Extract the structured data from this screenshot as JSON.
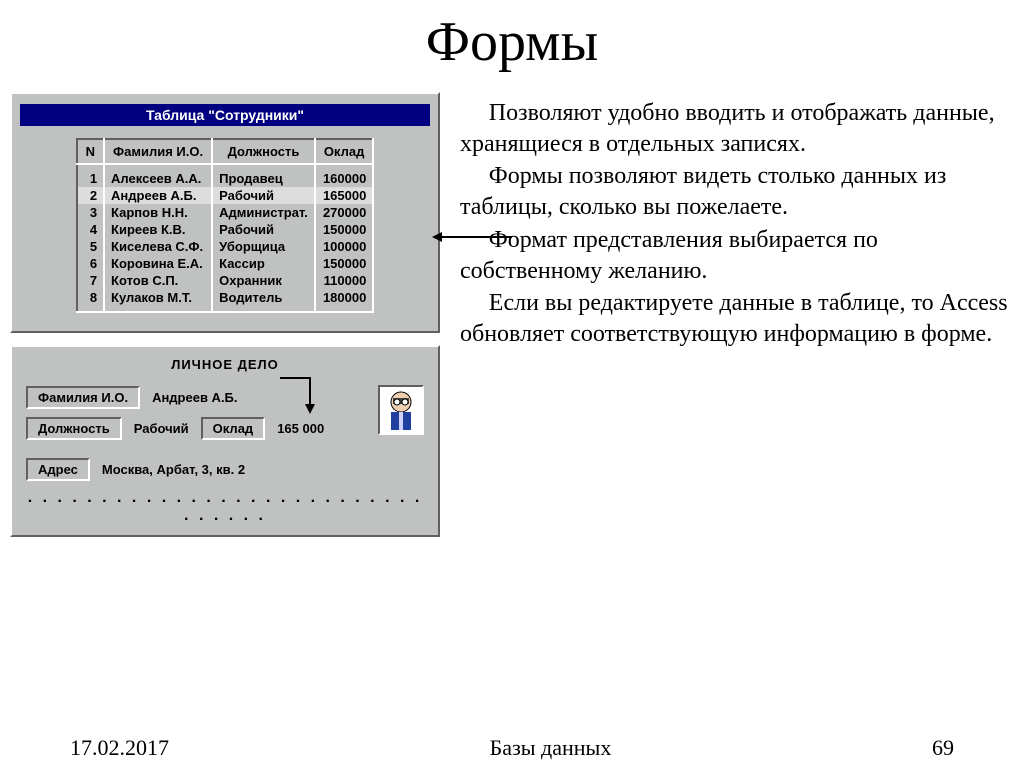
{
  "title": "Формы",
  "table_panel": {
    "title": "Таблица  \"Сотрудники\"",
    "headers": {
      "n": "N",
      "name": "Фамилия И.О.",
      "pos": "Должность",
      "sal": "Оклад"
    },
    "rows": [
      {
        "n": "1",
        "name": "Алексеев А.А.",
        "pos": "Продавец",
        "sal": "160000"
      },
      {
        "n": "2",
        "name": "Андреев А.Б.",
        "pos": "Рабочий",
        "sal": "165000"
      },
      {
        "n": "3",
        "name": "Карпов Н.Н.",
        "pos": "Администрат.",
        "sal": "270000"
      },
      {
        "n": "4",
        "name": "Киреев К.В.",
        "pos": "Рабочий",
        "sal": "150000"
      },
      {
        "n": "5",
        "name": "Киселева С.Ф.",
        "pos": "Уборщица",
        "sal": "100000"
      },
      {
        "n": "6",
        "name": "Коровина Е.А.",
        "pos": "Кассир",
        "sal": "150000"
      },
      {
        "n": "7",
        "name": "Котов С.П.",
        "pos": "Охранник",
        "sal": "110000"
      },
      {
        "n": "8",
        "name": "Кулаков М.Т.",
        "pos": "Водитель",
        "sal": "180000"
      }
    ]
  },
  "form_panel": {
    "title": "ЛИЧНОЕ  ДЕЛО",
    "labels": {
      "name": "Фамилия И.О.",
      "pos": "Должность",
      "sal": "Оклад",
      "addr": "Адрес"
    },
    "values": {
      "name": "Андреев А.Б.",
      "pos": "Рабочий",
      "sal": "165 000",
      "addr": "Москва, Арбат, 3, кв. 2",
      "dots": ". . . . . . . . . . . . . . . . . . . . . . . . . . . . . . . . ."
    }
  },
  "body_text": {
    "p1": "Позволяют удобно вводить и отображать данные, хранящиеся в отдельных записях.",
    "p2": "Формы позволяют видеть столько данных из таблицы, сколько вы пожелаете.",
    "p3": "Формат представления выбирается по собственному желанию.",
    "p4": "Если вы редактируете данные в таблице, то Access обновляет соответствующую информацию в форме."
  },
  "footer": {
    "date": "17.02.2017",
    "subject": "Базы данных",
    "page": "69"
  }
}
